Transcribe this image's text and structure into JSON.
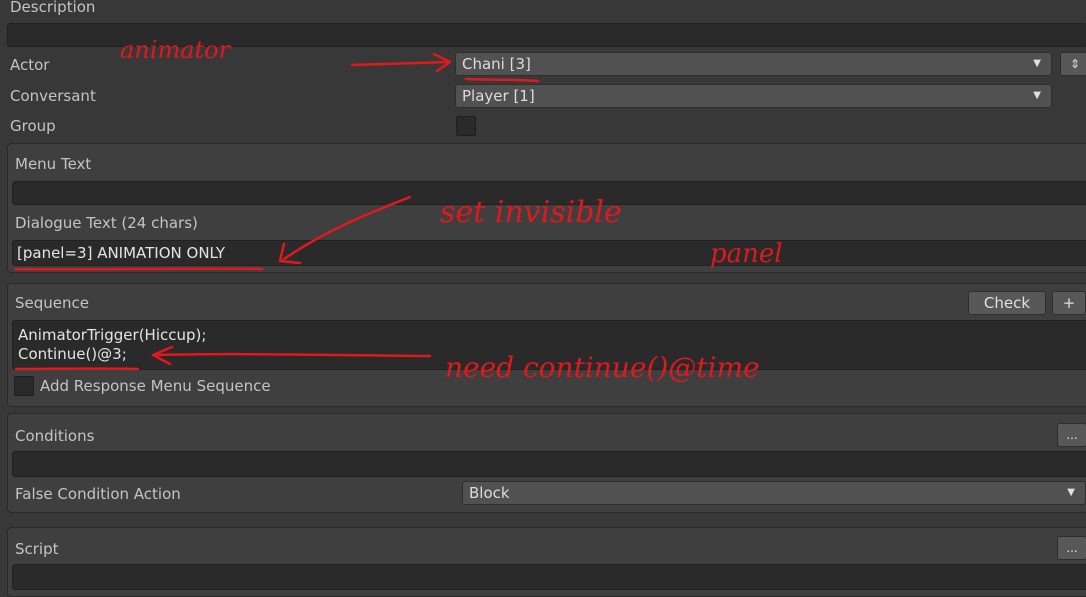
{
  "labels": {
    "description": "Description",
    "actor": "Actor",
    "conversant": "Conversant",
    "group": "Group",
    "menu_text": "Menu Text",
    "dialogue_text": "Dialogue Text (24 chars)",
    "sequence": "Sequence",
    "add_response": "Add Response Menu Sequence",
    "conditions": "Conditions",
    "false_condition_action": "False Condition Action",
    "script": "Script"
  },
  "values": {
    "actor": "Chani [3]",
    "conversant": "Player [1]",
    "dialogue_text": "[panel=3] ANIMATION ONLY",
    "sequence_line1": "AnimatorTrigger(Hiccup);",
    "sequence_line2": "Continue()@3;",
    "false_condition_action": "Block"
  },
  "buttons": {
    "check": "Check",
    "plus": "+",
    "ellipsis": "..."
  },
  "icons": {
    "dropdown_arrow": "▼",
    "stepper": "⇕"
  },
  "annotations": {
    "animator": "animator",
    "set_invisible": "set invisible",
    "panel": "panel",
    "need_continue": "need continue()@time",
    "color": "#e0191e"
  }
}
